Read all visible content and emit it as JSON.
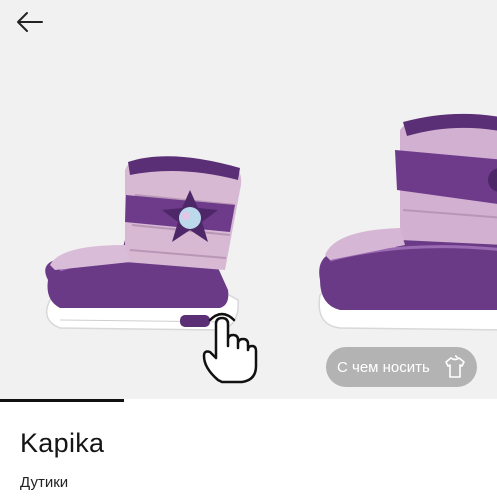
{
  "product": {
    "brand": "Kapika",
    "category": "Дутики"
  },
  "gallery": {
    "outfit_button_label": "С чем носить",
    "progress_fraction": 0.25
  },
  "icons": {
    "back": "arrow-left-icon",
    "hint": "swipe-hand-icon",
    "outfit": "tshirt-hanger-icon"
  },
  "colors": {
    "boot_purple": "#6a3a86",
    "boot_pink": "#d7b9d4",
    "sole": "#ffffff",
    "pill_bg": "#8c8c8c"
  }
}
